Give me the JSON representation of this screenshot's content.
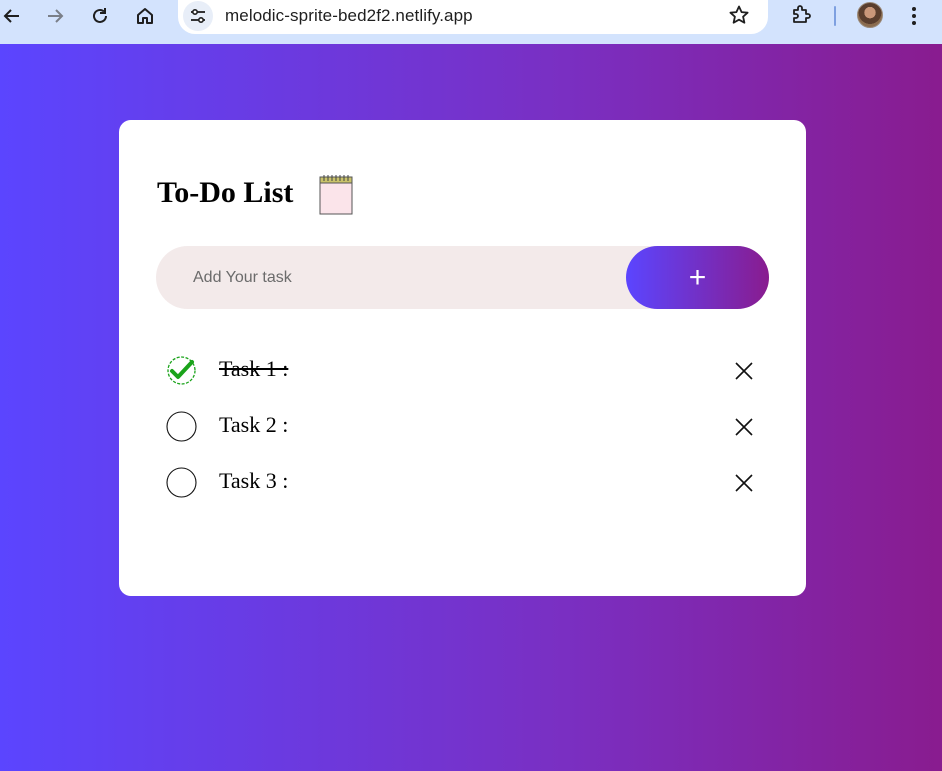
{
  "browser": {
    "url": "melodic-sprite-bed2f2.netlify.app"
  },
  "app": {
    "title": "To-Do List",
    "input_placeholder": "Add Your task",
    "add_button_label": "+",
    "tasks": [
      {
        "label": "Task 1 :",
        "completed": true
      },
      {
        "label": "Task 2 :",
        "completed": false
      },
      {
        "label": "Task 3 :",
        "completed": false
      }
    ]
  },
  "colors": {
    "gradient_start": "#5b45ff",
    "gradient_end": "#891c8f",
    "check_green": "#1aa31a",
    "input_bg": "#f3eaea"
  },
  "icons": {
    "back": "arrow-left-icon",
    "forward": "arrow-right-icon",
    "reload": "reload-icon",
    "home": "home-icon",
    "site_info": "tune-icon",
    "bookmark": "star-icon",
    "extensions": "puzzle-icon",
    "menu": "kebab-menu-icon",
    "title": "notepad-icon",
    "complete": "check-circle-icon",
    "incomplete": "circle-icon",
    "delete": "close-icon"
  }
}
